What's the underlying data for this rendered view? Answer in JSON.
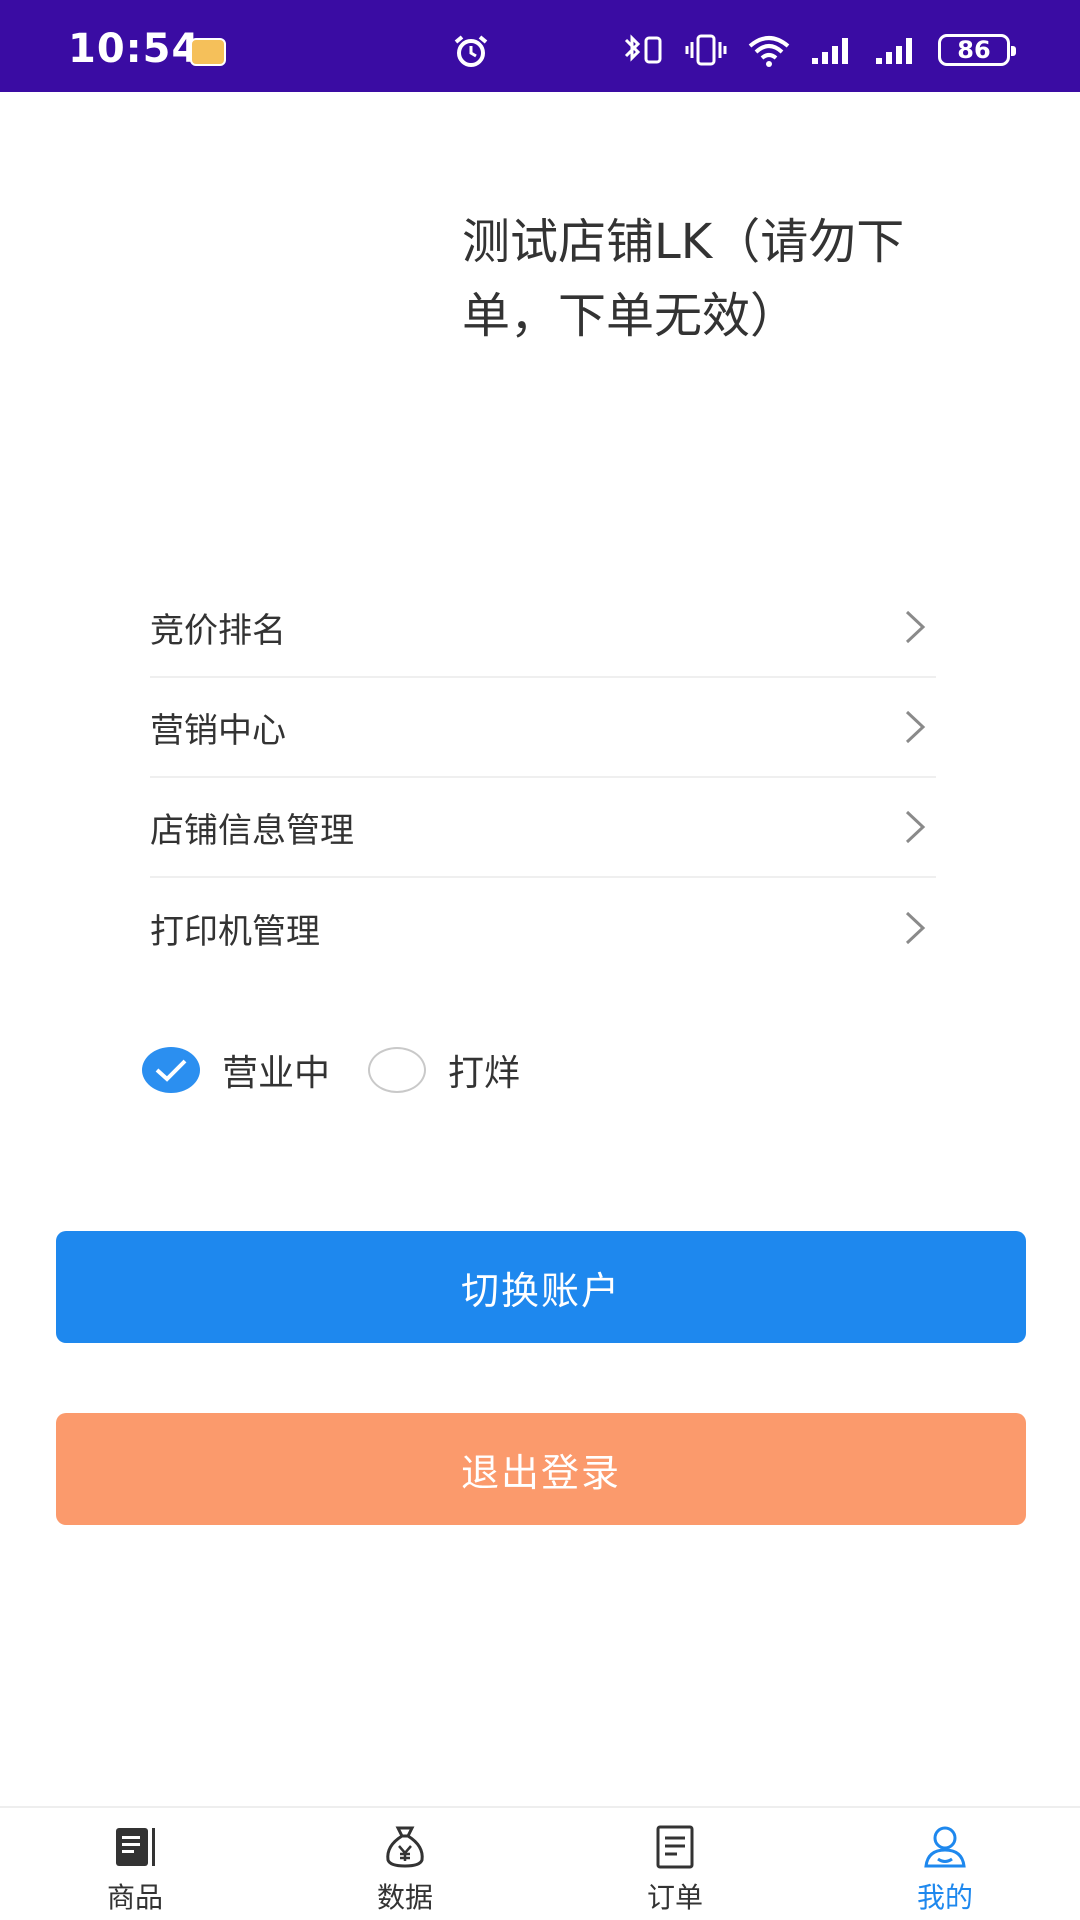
{
  "status_bar": {
    "time": "10:54",
    "battery": "86",
    "icons": [
      "app-notification-icon",
      "alarm-icon",
      "bluetooth-icon",
      "vibrate-icon",
      "wifi-icon",
      "signal-icon",
      "battery-icon"
    ]
  },
  "shop": {
    "name": "测试店铺LK（请勿下单，下单无效）"
  },
  "menu": {
    "items": [
      {
        "label": "竞价排名"
      },
      {
        "label": "营销中心"
      },
      {
        "label": "店铺信息管理"
      },
      {
        "label": "打印机管理"
      }
    ]
  },
  "business_status": {
    "options": [
      {
        "label": "营业中",
        "checked": true
      },
      {
        "label": "打烊",
        "checked": false
      }
    ]
  },
  "buttons": {
    "switch_account": "切换账户",
    "logout": "退出登录"
  },
  "bottom_nav": {
    "items": [
      {
        "label": "商品",
        "icon": "goods-icon"
      },
      {
        "label": "数据",
        "icon": "money-bag-icon"
      },
      {
        "label": "订单",
        "icon": "order-icon"
      },
      {
        "label": "我的",
        "icon": "profile-icon"
      }
    ],
    "active_index": 3
  },
  "colors": {
    "status_bar": "#3a0ca3",
    "primary": "#1e88ee",
    "logout": "#fb9a6c"
  }
}
